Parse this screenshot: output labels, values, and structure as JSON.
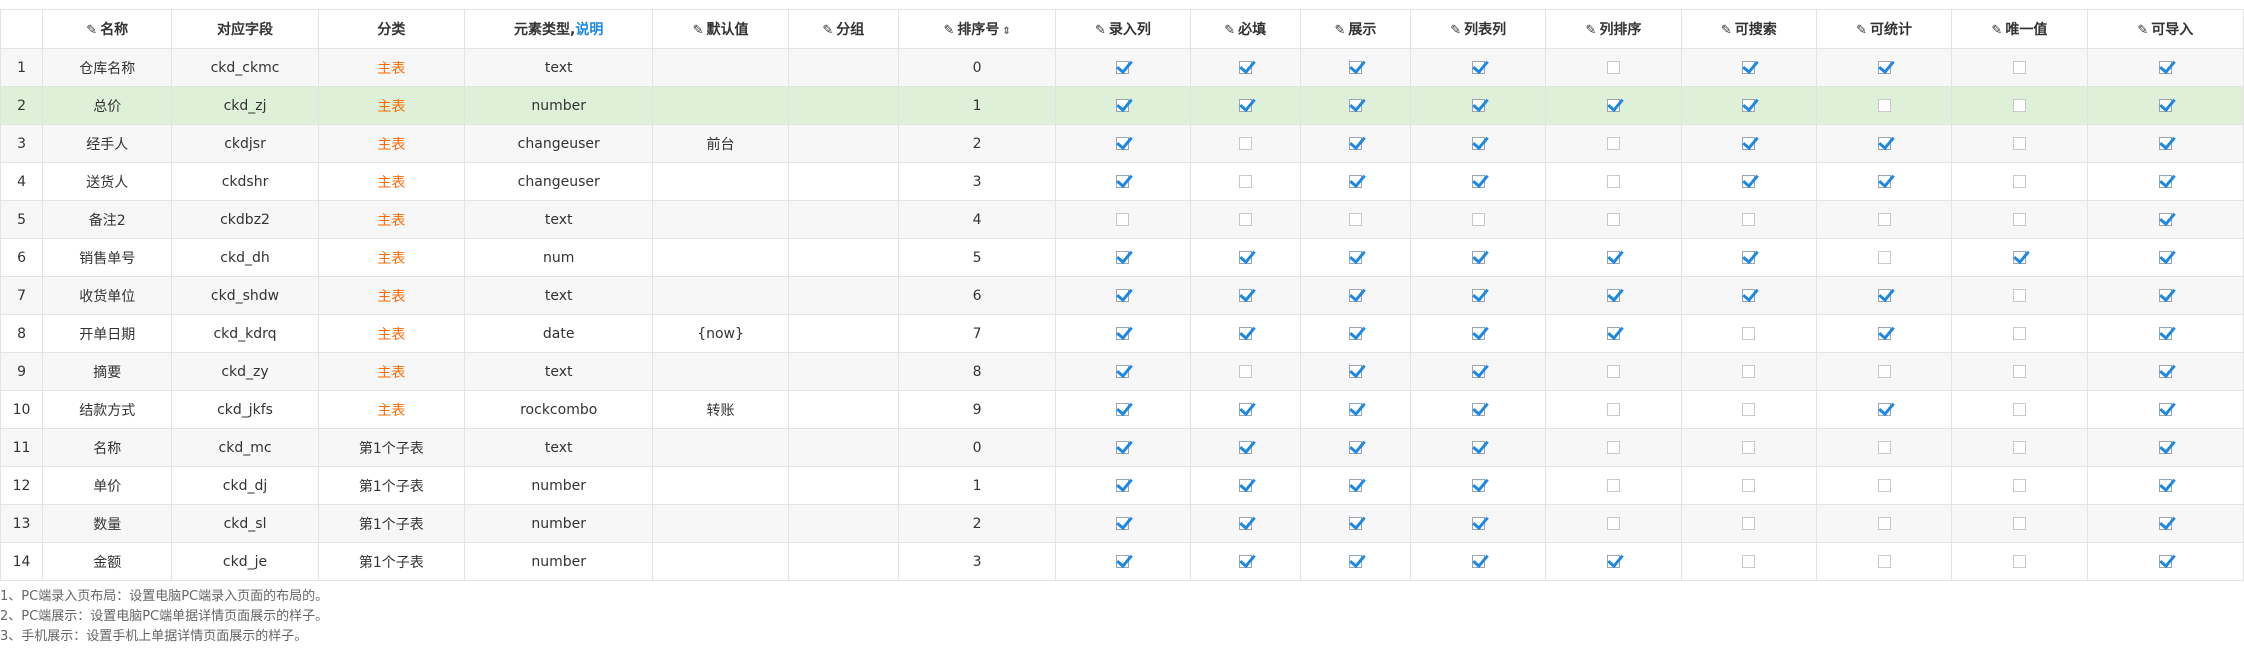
{
  "headers": {
    "index": "",
    "name": "名称",
    "field": "对应字段",
    "category": "分类",
    "type_prefix": "元素类型,",
    "type_link": "说明",
    "default_val": "默认值",
    "group": "分组",
    "sort_order": "排序号",
    "input_col": "录入列",
    "required": "必填",
    "display": "展示",
    "list_col": "列表列",
    "list_sort": "列排序",
    "searchable": "可搜索",
    "countable": "可统计",
    "unique": "唯一值",
    "importable": "可导入"
  },
  "rows": [
    {
      "idx": "1",
      "name": "仓库名称",
      "field": "ckd_ckmc",
      "cat": "主表",
      "cat_main": true,
      "type": "text",
      "def": "",
      "group": "",
      "sort": "0",
      "checks": [
        1,
        1,
        1,
        1,
        0,
        1,
        1,
        0,
        1
      ]
    },
    {
      "idx": "2",
      "name": "总价",
      "field": "ckd_zj",
      "cat": "主表",
      "cat_main": true,
      "type": "number",
      "def": "",
      "group": "",
      "sort": "1",
      "checks": [
        1,
        1,
        1,
        1,
        1,
        1,
        0,
        0,
        1
      ],
      "highlight": true
    },
    {
      "idx": "3",
      "name": "经手人",
      "field": "ckdjsr",
      "cat": "主表",
      "cat_main": true,
      "type": "changeuser",
      "def": "前台",
      "group": "",
      "sort": "2",
      "checks": [
        1,
        0,
        1,
        1,
        0,
        1,
        1,
        0,
        1
      ]
    },
    {
      "idx": "4",
      "name": "送货人",
      "field": "ckdshr",
      "cat": "主表",
      "cat_main": true,
      "type": "changeuser",
      "def": "",
      "group": "",
      "sort": "3",
      "checks": [
        1,
        0,
        1,
        1,
        0,
        1,
        1,
        0,
        1
      ]
    },
    {
      "idx": "5",
      "name": "备注2",
      "field": "ckdbz2",
      "cat": "主表",
      "cat_main": true,
      "type": "text",
      "def": "",
      "group": "",
      "sort": "4",
      "checks": [
        0,
        0,
        0,
        0,
        0,
        0,
        0,
        0,
        1
      ]
    },
    {
      "idx": "6",
      "name": "销售单号",
      "field": "ckd_dh",
      "cat": "主表",
      "cat_main": true,
      "type": "num",
      "def": "",
      "group": "",
      "sort": "5",
      "checks": [
        1,
        1,
        1,
        1,
        1,
        1,
        0,
        1,
        1
      ]
    },
    {
      "idx": "7",
      "name": "收货单位",
      "field": "ckd_shdw",
      "cat": "主表",
      "cat_main": true,
      "type": "text",
      "def": "",
      "group": "",
      "sort": "6",
      "checks": [
        1,
        1,
        1,
        1,
        1,
        1,
        1,
        0,
        1
      ]
    },
    {
      "idx": "8",
      "name": "开单日期",
      "field": "ckd_kdrq",
      "cat": "主表",
      "cat_main": true,
      "type": "date",
      "def": "{now}",
      "group": "",
      "sort": "7",
      "checks": [
        1,
        1,
        1,
        1,
        1,
        0,
        1,
        0,
        1
      ]
    },
    {
      "idx": "9",
      "name": "摘要",
      "field": "ckd_zy",
      "cat": "主表",
      "cat_main": true,
      "type": "text",
      "def": "",
      "group": "",
      "sort": "8",
      "checks": [
        1,
        0,
        1,
        1,
        0,
        0,
        0,
        0,
        1
      ]
    },
    {
      "idx": "10",
      "name": "结款方式",
      "field": "ckd_jkfs",
      "cat": "主表",
      "cat_main": true,
      "type": "rockcombo",
      "def": "转账",
      "group": "",
      "sort": "9",
      "checks": [
        1,
        1,
        1,
        1,
        0,
        0,
        1,
        0,
        1
      ]
    },
    {
      "idx": "11",
      "name": "名称",
      "field": "ckd_mc",
      "cat": "第1个子表",
      "cat_main": false,
      "type": "text",
      "def": "",
      "group": "",
      "sort": "0",
      "checks": [
        1,
        1,
        1,
        1,
        0,
        0,
        0,
        0,
        1
      ]
    },
    {
      "idx": "12",
      "name": "单价",
      "field": "ckd_dj",
      "cat": "第1个子表",
      "cat_main": false,
      "type": "number",
      "def": "",
      "group": "",
      "sort": "1",
      "checks": [
        1,
        1,
        1,
        1,
        0,
        0,
        0,
        0,
        1
      ]
    },
    {
      "idx": "13",
      "name": "数量",
      "field": "ckd_sl",
      "cat": "第1个子表",
      "cat_main": false,
      "type": "number",
      "def": "",
      "group": "",
      "sort": "2",
      "checks": [
        1,
        1,
        1,
        1,
        0,
        0,
        0,
        0,
        1
      ]
    },
    {
      "idx": "14",
      "name": "金额",
      "field": "ckd_je",
      "cat": "第1个子表",
      "cat_main": false,
      "type": "number",
      "def": "",
      "group": "",
      "sort": "3",
      "checks": [
        1,
        1,
        1,
        1,
        1,
        0,
        0,
        0,
        1
      ]
    }
  ],
  "notes": [
    "1、PC端录入页布局：设置电脑PC端录入页面的布局的。",
    "2、PC端展示：设置电脑PC端单据详情页面展示的样子。",
    "3、手机展示：设置手机上单据详情页面展示的样子。"
  ],
  "colors": {
    "accent": "#1e88e5",
    "main_category": "#ff6a00",
    "highlight_row": "#dff0d8"
  },
  "icons": {
    "edit": "pencil-icon",
    "sort": "sort-updown-icon",
    "checkbox": "checkbox-icon"
  }
}
